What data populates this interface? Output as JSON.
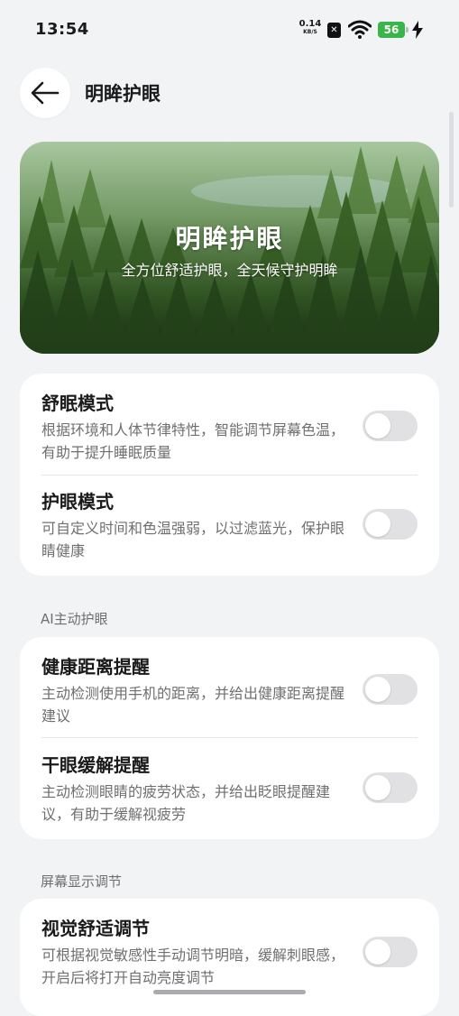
{
  "status_bar": {
    "time": "13:54",
    "net_speed_value": "0.14",
    "net_speed_unit": "KB/S",
    "battery_level": "56",
    "battery_color": "#3ab54a"
  },
  "header": {
    "title": "明眸护眼",
    "back_icon": "arrow-left-icon"
  },
  "hero": {
    "title": "明眸护眼",
    "subtitle": "全方位舒适护眼，全天候守护明眸"
  },
  "modes": [
    {
      "title": "舒眠模式",
      "desc": "根据环境和人体节律特性，智能调节屏幕色温，有助于提升睡眠质量",
      "enabled": false
    },
    {
      "title": "护眼模式",
      "desc": "可自定义时间和色温强弱，以过滤蓝光，保护眼睛健康",
      "enabled": false
    }
  ],
  "ai_section": {
    "header": "AI主动护眼",
    "items": [
      {
        "title": "健康距离提醒",
        "desc": "主动检测使用手机的距离，并给出健康距离提醒建议",
        "enabled": false
      },
      {
        "title": "干眼缓解提醒",
        "desc": "主动检测眼睛的疲劳状态，并给出眨眼提醒建议，有助于缓解视疲劳",
        "enabled": false
      }
    ]
  },
  "display_section": {
    "header": "屏幕显示调节",
    "items": [
      {
        "title": "视觉舒适调节",
        "desc": "可根据视觉敏感性手动调节明暗，缓解刺眼感，开启后将打开自动亮度调节",
        "enabled": false
      }
    ]
  },
  "colors": {
    "background": "#f1f3f5",
    "card": "#ffffff",
    "toggle_off": "#e1e1e3",
    "secondary_text": "#6f6f72"
  }
}
